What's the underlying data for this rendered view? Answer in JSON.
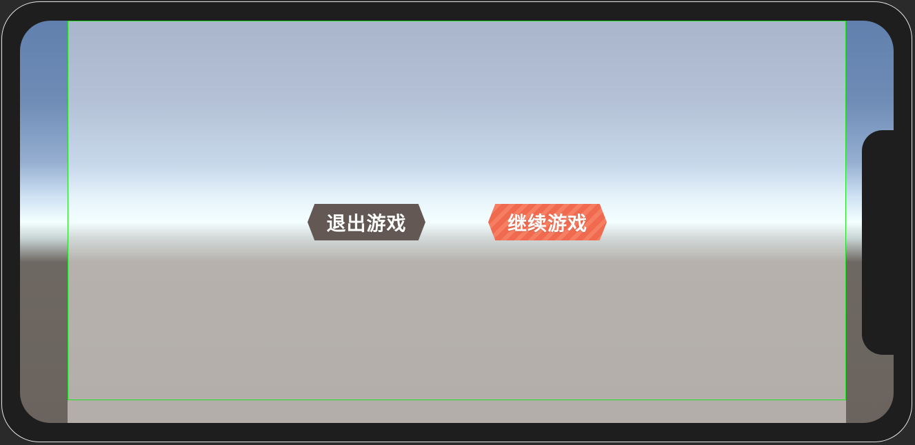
{
  "dialog": {
    "exit_label": "退出游戏",
    "continue_label": "继续游戏"
  },
  "colors": {
    "exit_button": "#635853",
    "continue_button": "#f06a4f",
    "safe_area_border": "#1fe41f",
    "device_frame": "#1e1e1e"
  }
}
